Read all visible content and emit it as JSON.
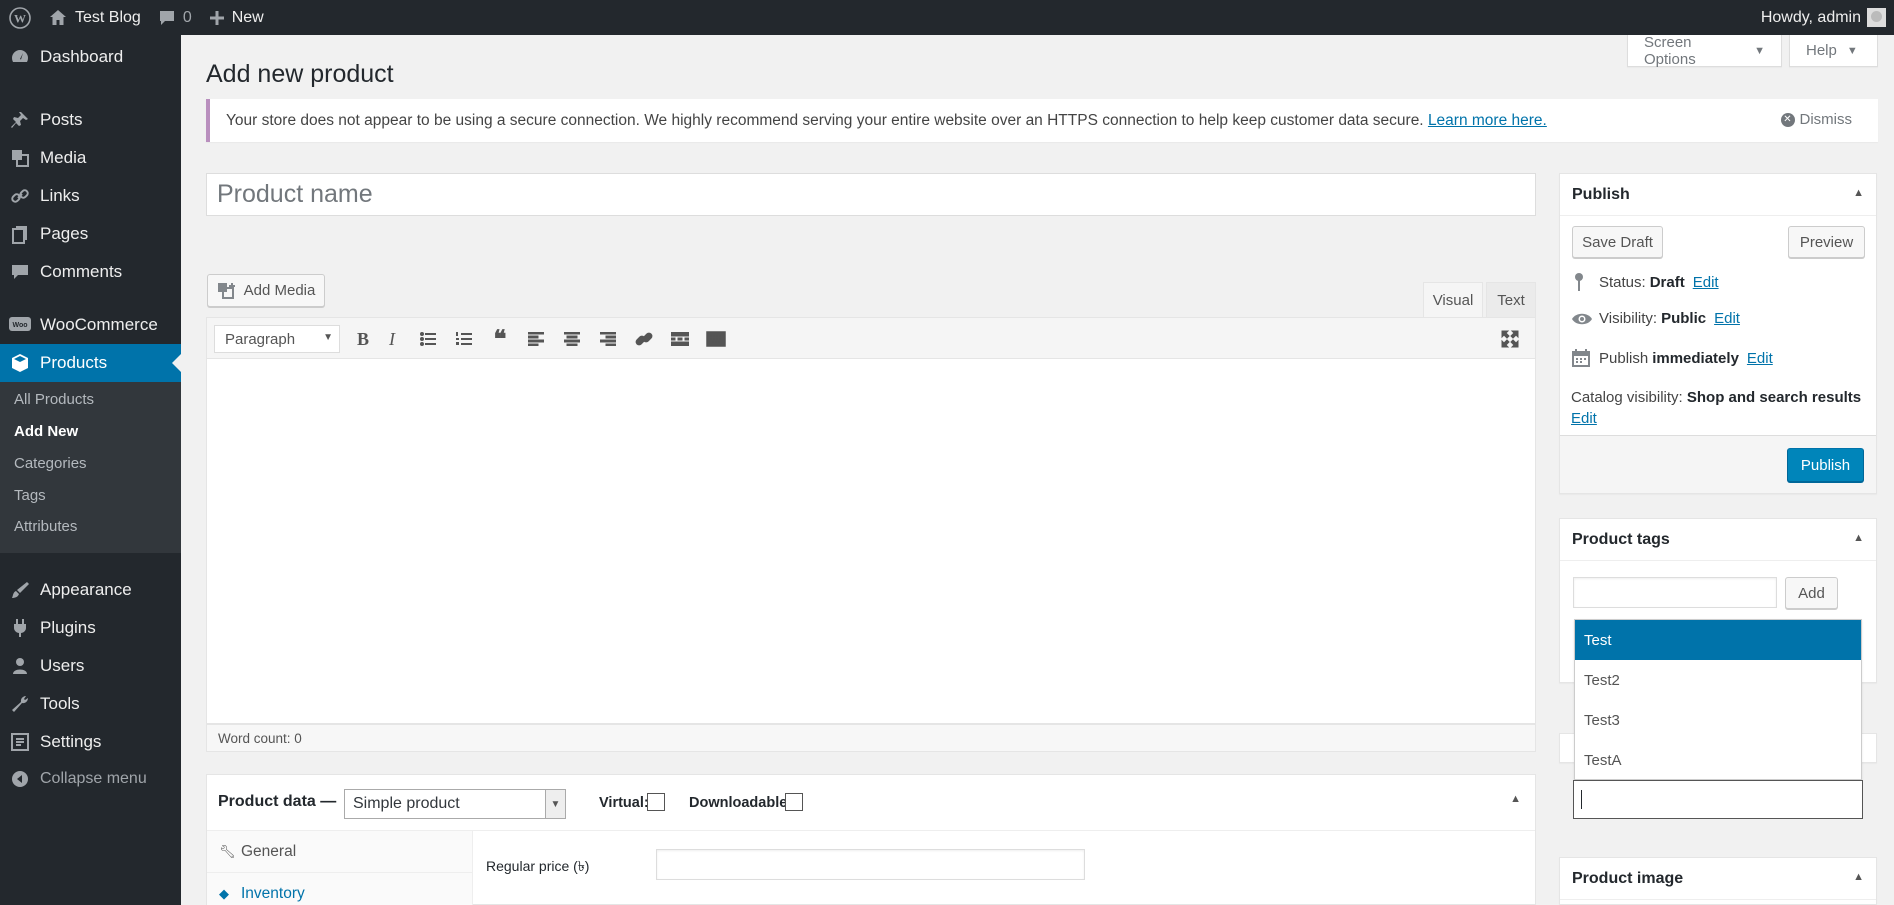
{
  "adminbar": {
    "site_name": "Test Blog",
    "comments_count": "0",
    "new_label": "New",
    "howdy": "Howdy, admin"
  },
  "sidebar": {
    "items": [
      {
        "label": "Dashboard",
        "icon": "dashboard-icon"
      },
      {
        "label": "Posts",
        "icon": "pushpin-icon"
      },
      {
        "label": "Media",
        "icon": "media-icon"
      },
      {
        "label": "Links",
        "icon": "link-icon"
      },
      {
        "label": "Pages",
        "icon": "pages-icon"
      },
      {
        "label": "Comments",
        "icon": "comment-icon"
      },
      {
        "label": "WooCommerce",
        "icon": "woocommerce-icon"
      },
      {
        "label": "Products",
        "icon": "products-icon"
      },
      {
        "label": "Appearance",
        "icon": "paintbrush-icon"
      },
      {
        "label": "Plugins",
        "icon": "plugin-icon"
      },
      {
        "label": "Users",
        "icon": "users-icon"
      },
      {
        "label": "Tools",
        "icon": "wrench-icon"
      },
      {
        "label": "Settings",
        "icon": "settings-icon"
      }
    ],
    "submenu": [
      "All Products",
      "Add New",
      "Categories",
      "Tags",
      "Attributes"
    ],
    "collapse_label": "Collapse menu"
  },
  "header": {
    "title": "Add new product",
    "screen_options": "Screen Options",
    "help": "Help"
  },
  "notice": {
    "text": "Your store does not appear to be using a secure connection. We highly recommend serving your entire website over an HTTPS connection to help keep customer data secure.",
    "link": "Learn more here.",
    "dismiss": "Dismiss"
  },
  "editor": {
    "title_placeholder": "Product name",
    "add_media": "Add Media",
    "tab_visual": "Visual",
    "tab_text": "Text",
    "format": "Paragraph",
    "word_count": "Word count: 0"
  },
  "product_data": {
    "title": "Product data —",
    "type": "Simple product",
    "virtual_label": "Virtual:",
    "downloadable_label": "Downloadable:",
    "tabs": [
      "General",
      "Inventory"
    ],
    "regular_price_label": "Regular price (৳)"
  },
  "publish": {
    "title": "Publish",
    "save_draft": "Save Draft",
    "preview": "Preview",
    "status_label": "Status:",
    "status_value": "Draft",
    "visibility_label": "Visibility:",
    "visibility_value": "Public",
    "publish_label": "Publish",
    "publish_value": "immediately",
    "catalog_label": "Catalog visibility:",
    "catalog_value": "Shop and search results",
    "edit": "Edit",
    "publish_button": "Publish"
  },
  "product_tags": {
    "title": "Product tags",
    "add": "Add",
    "suggestions": [
      "Test",
      "Test2",
      "Test3",
      "TestA"
    ]
  },
  "product_image": {
    "title": "Product image"
  },
  "colors": {
    "accent": "#0073aa",
    "sidebar": "#23282d",
    "primary_button": "#0085ba"
  }
}
